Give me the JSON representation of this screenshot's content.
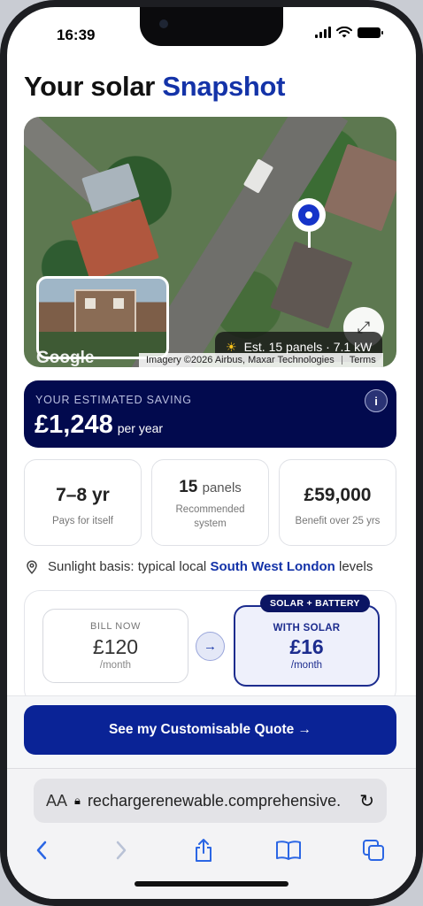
{
  "status_bar": {
    "time": "16:39",
    "icons": [
      "signal-icon",
      "wifi-icon",
      "battery-icon"
    ]
  },
  "header": {
    "title_prefix": "Your solar",
    "title_accent": "Snapshot",
    "accent_color": "#1433a8"
  },
  "map": {
    "panels_summary": "Est. 15 panels · 7.1 kW",
    "imagery_credit": "Imagery ©2026 Airbus, Maxar Technologies",
    "terms_link": "Terms",
    "google_logo": "Google",
    "pin_color": "#1634c9"
  },
  "saving": {
    "eyebrow": "YOUR ESTIMATED SAVING",
    "amount": "£1,248",
    "period": "per year",
    "bg_color": "#020a4e"
  },
  "stats": [
    {
      "value": "7–8 yr",
      "unit": "",
      "label": "Pays for itself"
    },
    {
      "value": "15",
      "unit": "panels",
      "label": "Recommended system"
    },
    {
      "value": "£59,000",
      "unit": "",
      "label": "Benefit over 25 yrs"
    }
  ],
  "sunlight": {
    "prefix": "Sunlight basis: typical local",
    "location": "South West London",
    "suffix": "levels"
  },
  "comparison": {
    "bill_now_label": "BILL NOW",
    "bill_now_amount": "£120",
    "bill_now_period": "/month",
    "badge": "SOLAR + BATTERY",
    "with_solar_label": "WITH SOLAR",
    "with_solar_amount": "£16",
    "with_solar_period": "/month"
  },
  "cta": {
    "label": "See my Customisable Quote →",
    "color": "#0a2396"
  },
  "safari": {
    "text_size_label": "AA",
    "url": "rechargerenewable.comprehensive.",
    "toolbar": [
      "back-icon",
      "forward-icon",
      "share-icon",
      "bookmarks-icon",
      "tabs-icon"
    ]
  }
}
